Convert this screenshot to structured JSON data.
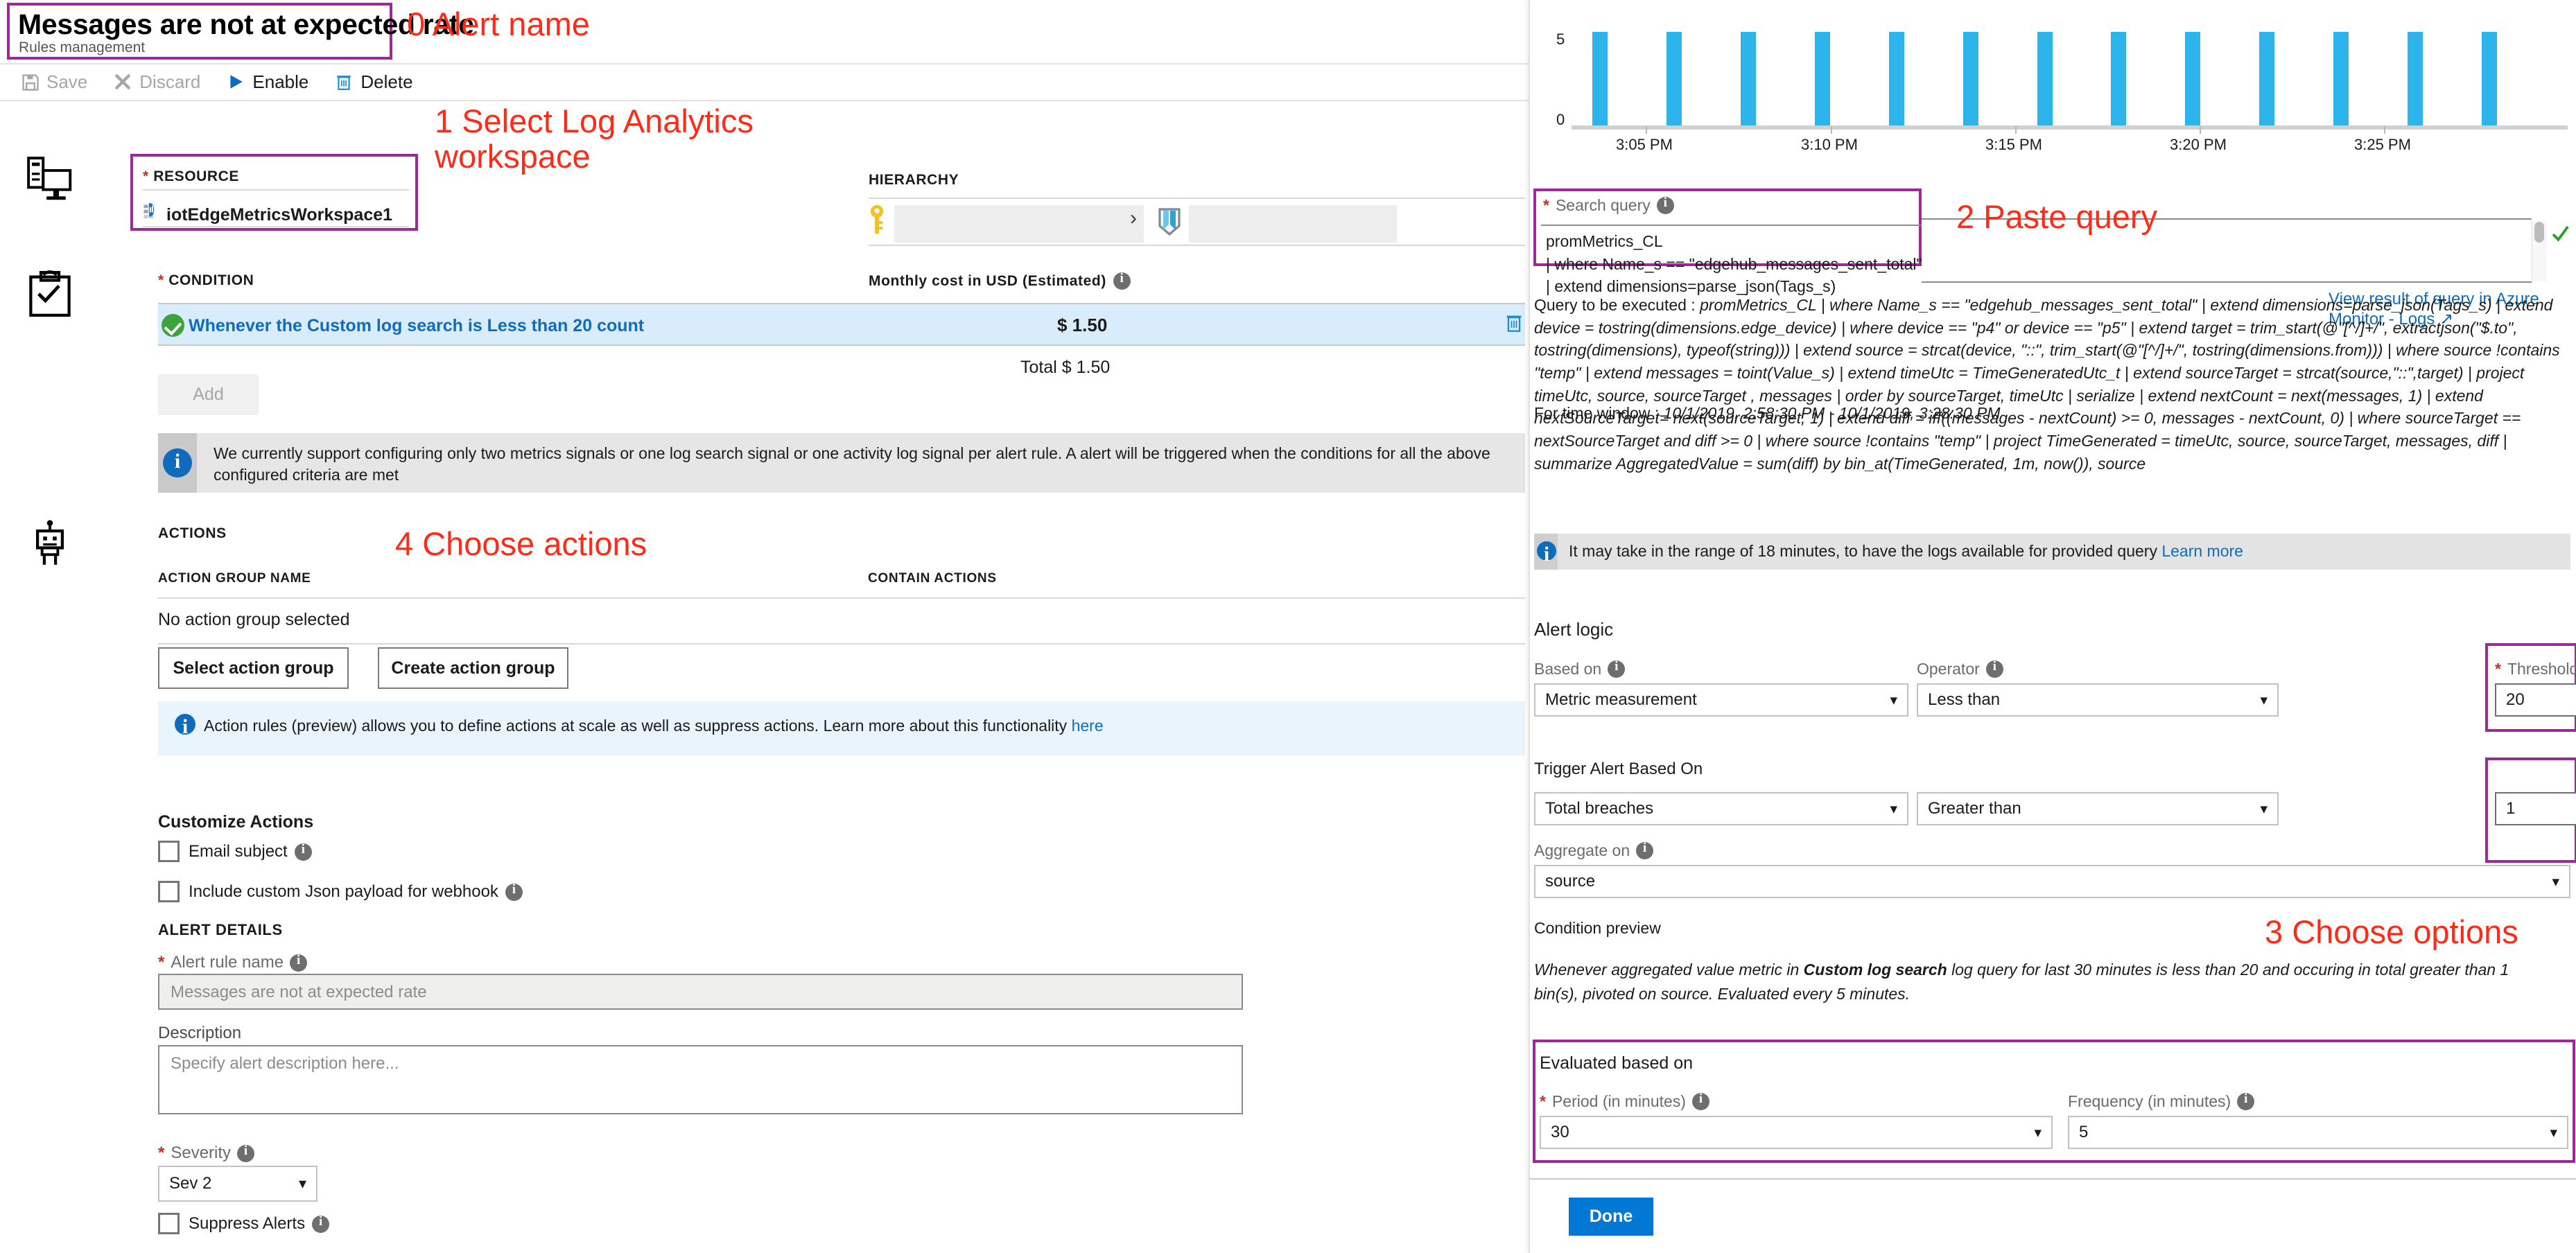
{
  "header": {
    "title": "Messages are not at expected rate",
    "subtitle": "Rules management"
  },
  "toolbar": {
    "save": "Save",
    "discard": "Discard",
    "enable": "Enable",
    "delete": "Delete"
  },
  "resource": {
    "label": "RESOURCE",
    "required_mark": "*",
    "value": "iotEdgeMetricsWorkspace1"
  },
  "hierarchy": {
    "label": "HIERARCHY"
  },
  "condition": {
    "label": "CONDITION",
    "required_mark": "*",
    "row_text": "Whenever the Custom log search is Less than 20 count",
    "cost_header": "Monthly cost in USD (Estimated)",
    "cost_value": "$ 1.50",
    "total_label": "Total",
    "total_value": "$ 1.50",
    "add_button": "Add",
    "info": "We currently support configuring only two metrics signals or one log search signal or one activity log signal per alert rule. A alert will be triggered when the conditions for all the above configured criteria are met"
  },
  "actions": {
    "header": "ACTIONS",
    "col_group_name": "ACTION GROUP NAME",
    "col_contain_actions": "CONTAIN ACTIONS",
    "empty": "No action group selected",
    "select_button": "Select action group",
    "create_button": "Create action group",
    "info_text": "Action rules (preview) allows you to define actions at scale as well as suppress actions. Learn more about this functionality",
    "info_link": "here"
  },
  "customize": {
    "header": "Customize Actions",
    "email_subject": "Email subject",
    "json_payload": "Include custom Json payload for webhook"
  },
  "alert_details": {
    "header": "ALERT DETAILS",
    "rule_name_label": "Alert rule name",
    "rule_name_value": "Messages are not at expected rate",
    "description_label": "Description",
    "description_placeholder": "Specify alert description here...",
    "severity_label": "Severity",
    "severity_value": "Sev 2",
    "suppress_label": "Suppress Alerts",
    "required_mark": "*"
  },
  "annotations": [
    {
      "id": "a0",
      "text": "0 Alert name"
    },
    {
      "id": "a1",
      "text": "1 Select Log Analytics\nworkspace"
    },
    {
      "id": "a2",
      "text": "2 Paste query"
    },
    {
      "id": "a3",
      "text": "3 Choose options"
    },
    {
      "id": "a4",
      "text": "4 Choose actions"
    }
  ],
  "search_query": {
    "label": "Search query",
    "required_mark": "*",
    "value": "promMetrics_CL\n| where Name_s == \"edgehub_messages_sent_total\"\n| extend dimensions=parse_json(Tags_s)",
    "view_result_link": "View result of query in Azure Monitor - Logs"
  },
  "query_preview": {
    "prefix": "Query to be executed : ",
    "query": "promMetrics_CL | where Name_s == \"edgehub_messages_sent_total\" | extend dimensions=parse_json(Tags_s) | extend device = tostring(dimensions.edge_device) | where device == \"p4\" or device == \"p5\" | extend target = trim_start(@\"[^/]+/\", extractjson(\"$.to\", tostring(dimensions), typeof(string))) | extend source = strcat(device, \"::\", trim_start(@\"[^/]+/\", tostring(dimensions.from))) | where source !contains \"temp\" | extend messages = toint(Value_s) | extend timeUtc = TimeGeneratedUtc_t | extend sourceTarget = strcat(source,\"::\",target) | project timeUtc, source, sourceTarget , messages | order by sourceTarget, timeUtc | serialize | extend nextCount = next(messages, 1) | extend nextSourceTarget= next(sourceTarget, 1) | extend diff = iff((messages - nextCount) >= 0, messages - nextCount, 0) | where sourceTarget == nextSourceTarget and diff >= 0 | where source !contains \"temp\" | project TimeGenerated = timeUtc, source, sourceTarget, messages, diff | summarize AggregatedValue = sum(diff) by bin_at(TimeGenerated, 1m, now()), source",
    "time_window_prefix": "For time window : ",
    "time_window": "10/1/2019, 2:58:30 PM - 10/1/2019, 3:28:30 PM"
  },
  "latency_info": {
    "text": "It may take in the range of 18 minutes, to have the logs available for provided query",
    "link": "Learn more"
  },
  "alert_logic": {
    "header": "Alert logic",
    "based_on_label": "Based on",
    "based_on_value": "Metric measurement",
    "operator_label": "Operator",
    "operator_value": "Less than",
    "threshold_label": "Threshold value",
    "threshold_value": "20",
    "threshold_required": "*"
  },
  "trigger": {
    "header": "Trigger Alert Based On",
    "breaches_value": "Total breaches",
    "comparison_value": "Greater than",
    "count_value": "1",
    "aggregate_label": "Aggregate on",
    "aggregate_value": "source"
  },
  "condition_preview": {
    "header": "Condition preview",
    "part1": "Whenever aggregated value metric in ",
    "bold": "Custom log search",
    "part2": " log query for last 30 minutes is less than 20 and occuring in total greater than 1 bin(s), pivoted on source. Evaluated every 5 minutes."
  },
  "evaluated": {
    "header": "Evaluated based on",
    "period_label": "Period (in minutes)",
    "period_value": "30",
    "period_required": "*",
    "frequency_label": "Frequency (in minutes)",
    "frequency_value": "5"
  },
  "done_button": "Done",
  "colors": {
    "annotation": "#ff2a17",
    "highlight_border": "#9b2a96",
    "accent_blue": "#0f6cbd",
    "bar_blue": "#2cb4eb",
    "primary_button": "#0078d4"
  },
  "chart_data": {
    "type": "bar",
    "title": "",
    "xlabel": "",
    "ylabel": "",
    "ylim": [
      0,
      6
    ],
    "yticks": [
      0,
      5
    ],
    "ytick_labels": [
      "0",
      "5"
    ],
    "xtick_labels": [
      "3:05 PM",
      "3:10 PM",
      "3:15 PM",
      "3:20 PM",
      "3:25 PM"
    ],
    "categories": [
      "3:04 PM",
      "3:06 PM",
      "3:08 PM",
      "3:10 PM",
      "3:12 PM",
      "3:14 PM",
      "3:16 PM",
      "3:18 PM",
      "3:20 PM",
      "3:22 PM",
      "3:24 PM",
      "3:26 PM",
      "3:28 PM"
    ],
    "values": [
      6,
      6,
      6,
      6,
      6,
      6,
      6,
      6,
      6,
      6,
      6,
      6,
      6
    ],
    "grid": false,
    "legend": false,
    "series_color": "#2cb4eb"
  }
}
